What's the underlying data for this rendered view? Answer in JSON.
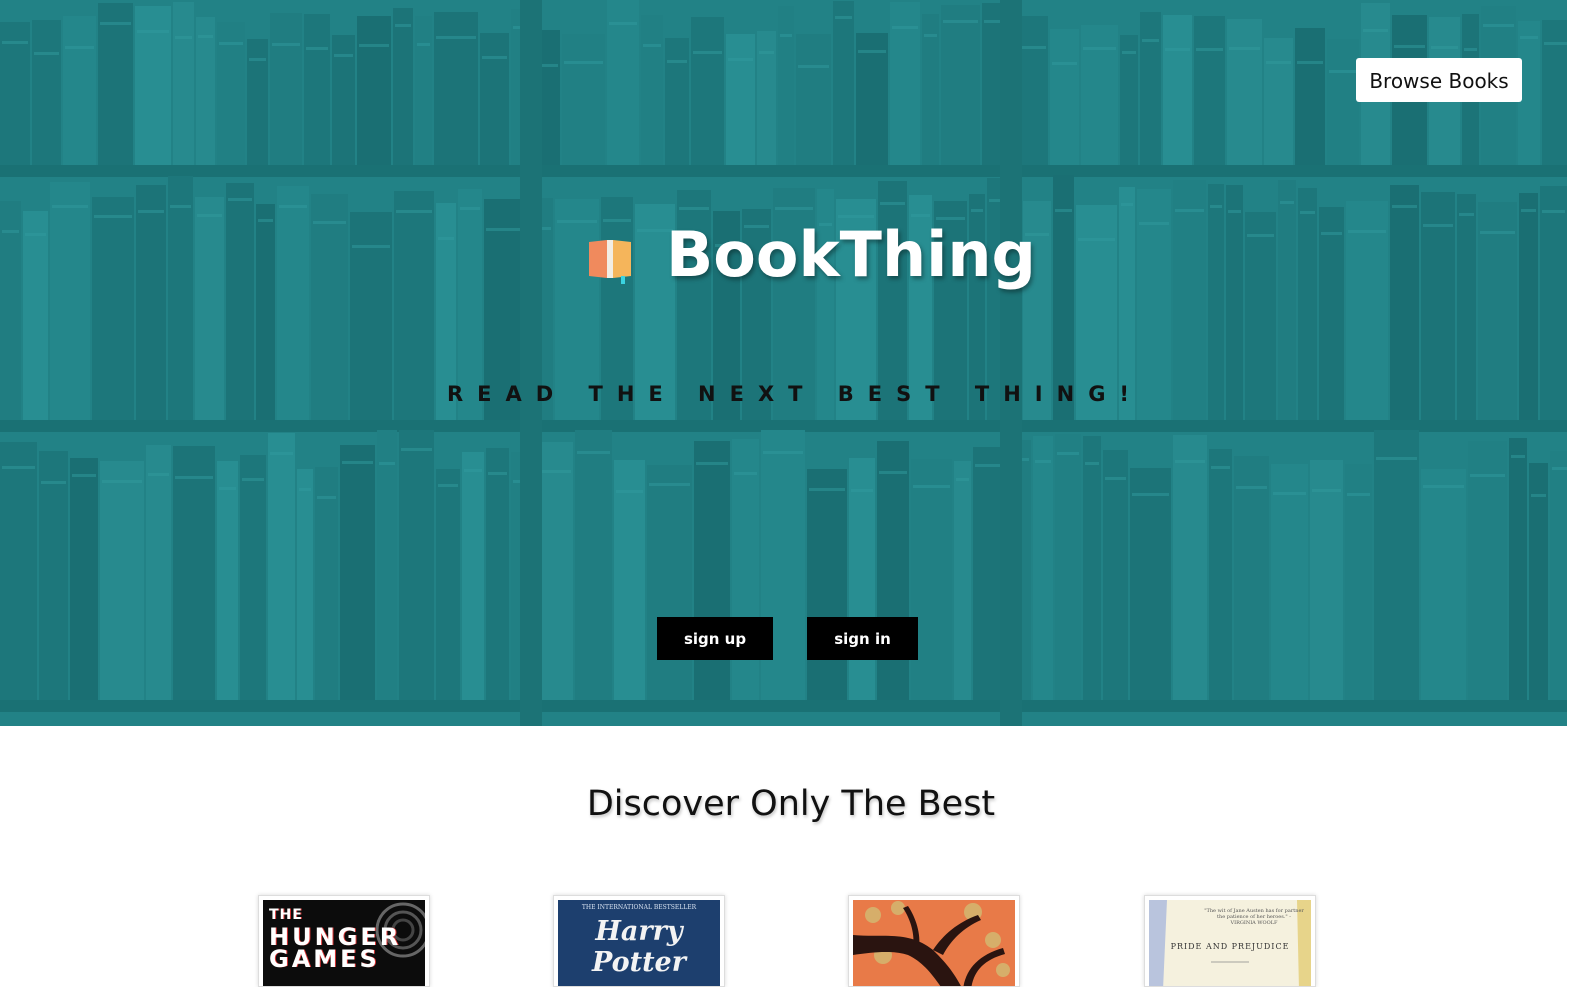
{
  "header": {
    "browse_label": "Browse Books"
  },
  "hero": {
    "brand": "BookThing",
    "logo_icon": "open-book-icon",
    "tagline": "READ THE NEXT BEST THING!",
    "signup_label": "sign up",
    "signin_label": "sign in",
    "accent_color": "#2a9599"
  },
  "discover": {
    "title": "Discover Only The Best",
    "books": [
      {
        "cover_text_small": "THE",
        "cover_text_line1": "HUNGER",
        "cover_text_line2": "GAMES"
      },
      {
        "cover_tagline": "THE INTERNATIONAL BESTSELLER",
        "cover_text": "Harry Potter"
      },
      {
        "cover_icon": "tree-icon"
      },
      {
        "cover_quote": "\"The wit of Jane Austen has for partner the patience of her heroes.\" - VIRGINIA WOOLF",
        "cover_text": "PRIDE AND PREJUDICE"
      }
    ]
  }
}
